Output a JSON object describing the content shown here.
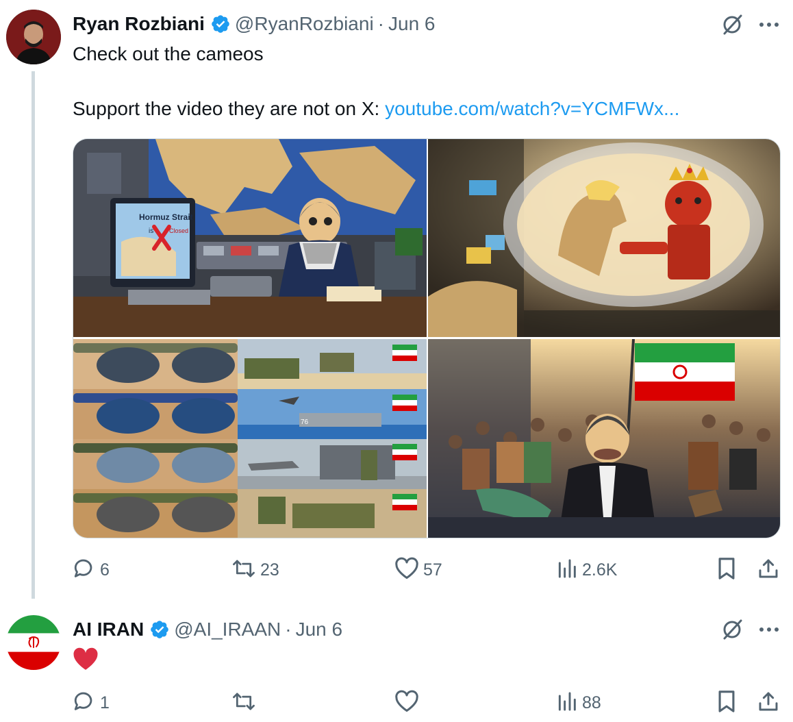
{
  "tweet": {
    "author_name": "Ryan Rozbiani",
    "handle": "@RyanRozbiani",
    "separator": "·",
    "date": "Jun 6",
    "text_line_1": "Check out the cameos",
    "text_line_2_prefix": "Support the video they are not on X: ",
    "link_text": "youtube.com/watch?v=YCMFWx...",
    "media": [
      {
        "text_1": "Hormuz Strait",
        "text_2": "is",
        "text_3": "Closed"
      },
      {},
      {
        "text_1": "76"
      },
      {}
    ],
    "stats": {
      "replies": "6",
      "reposts": "23",
      "likes": "57",
      "views": "2.6K"
    }
  },
  "reply": {
    "author_name": "AI IRAN",
    "handle": "@AI_IRAAN",
    "separator": "·",
    "date": "Jun 6",
    "emoji": "heart-emoji",
    "stats": {
      "replies": "1",
      "reposts": "",
      "likes": "",
      "views": "88"
    }
  },
  "colors": {
    "verified": "#1d9bf0",
    "link": "#1d9bf0",
    "muted": "#536471",
    "thread_line": "#cfd9de",
    "heart": "#e0245e"
  },
  "icons": [
    "verified-badge-icon",
    "grok-icon",
    "more-icon",
    "reply-icon",
    "repost-icon",
    "like-icon",
    "views-icon",
    "bookmark-icon",
    "share-icon"
  ]
}
